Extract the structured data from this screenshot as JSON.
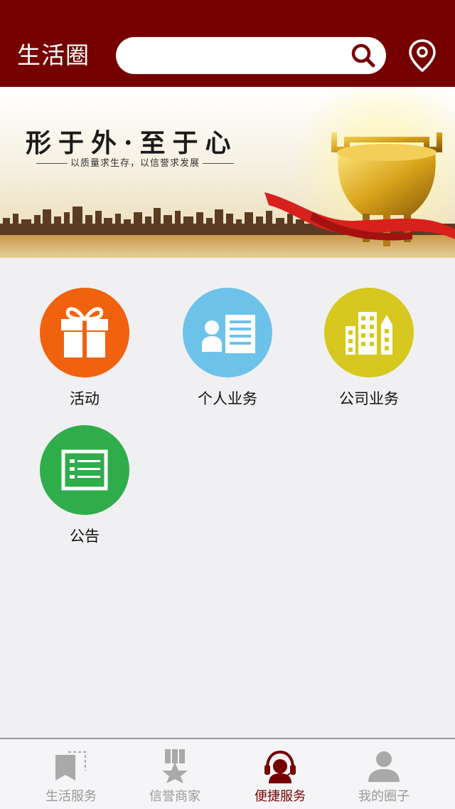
{
  "header": {
    "title": "生活圈",
    "search_placeholder": "",
    "search_icon": "search-icon",
    "location_icon": "location-pin-icon"
  },
  "banner": {
    "slogan": "形于外·至于心",
    "subtitle": "以质量求生存，以信誉求发展"
  },
  "services": [
    {
      "label": "活动",
      "icon": "gift-icon",
      "color": "#f0620d"
    },
    {
      "label": "个人业务",
      "icon": "person-card-icon",
      "color": "#6dc2ea"
    },
    {
      "label": "公司业务",
      "icon": "buildings-icon",
      "color": "#d6c81f"
    },
    {
      "label": "公告",
      "icon": "list-board-icon",
      "color": "#2fad4b"
    }
  ],
  "tabbar": {
    "active_color": "#760000",
    "inactive_color": "#999999",
    "tabs": [
      {
        "label": "生活服务",
        "icon": "bookmark-icon",
        "active": false
      },
      {
        "label": "信誉商家",
        "icon": "medal-star-icon",
        "active": false
      },
      {
        "label": "便捷服务",
        "icon": "headset-agent-icon",
        "active": true
      },
      {
        "label": "我的圈子",
        "icon": "user-icon",
        "active": false
      }
    ]
  }
}
